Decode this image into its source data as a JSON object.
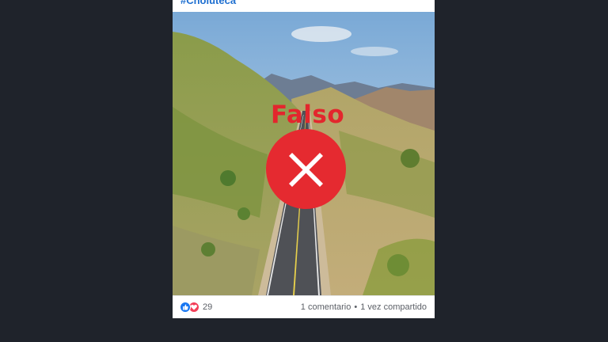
{
  "post": {
    "hashtag": "#Choluteca",
    "verdict_label": "Falso",
    "verdict_icon": "x-mark-icon",
    "verdict_color": "#e3262d",
    "reaction_icons": [
      "like-icon",
      "love-icon"
    ],
    "reaction_count": "29",
    "comments": "1 comentario",
    "separator": "•",
    "shares": "1 vez compartido"
  }
}
